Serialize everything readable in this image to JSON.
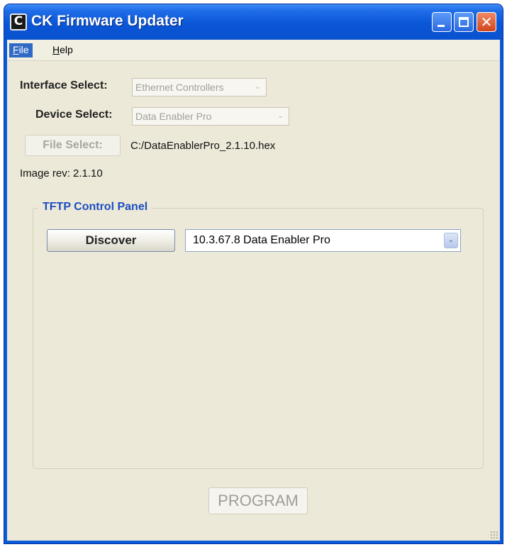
{
  "window": {
    "title": "CK Firmware Updater",
    "app_icon_glyph": "C",
    "minimize_icon": "minimize-icon",
    "maximize_icon": "maximize-icon",
    "close_icon": "close-icon",
    "close_glyph": "✕"
  },
  "menu": {
    "file_first": "F",
    "file_rest": "ile",
    "help_first": "H",
    "help_rest": "elp"
  },
  "form": {
    "interface_label": "Interface Select:",
    "interface_value": "Ethernet Controllers",
    "device_label": "Device Select:",
    "device_value": "Data Enabler Pro",
    "file_select_button": "File Select:",
    "file_path": "C:/DataEnablerPro_2.1.10.hex",
    "image_rev": "Image rev: 2.1.10",
    "dropdown_arrow": "⌄"
  },
  "tftp": {
    "title": "TFTP Control Panel",
    "discover_button": "Discover",
    "discovered_device": "10.3.67.8 Data Enabler Pro"
  },
  "actions": {
    "program_button": "PROGRAM"
  },
  "colors": {
    "titlebar": "#0a56d6",
    "client_bg": "#ece9d8",
    "group_title": "#1c4ec2",
    "menu_highlight": "#316ac5"
  }
}
